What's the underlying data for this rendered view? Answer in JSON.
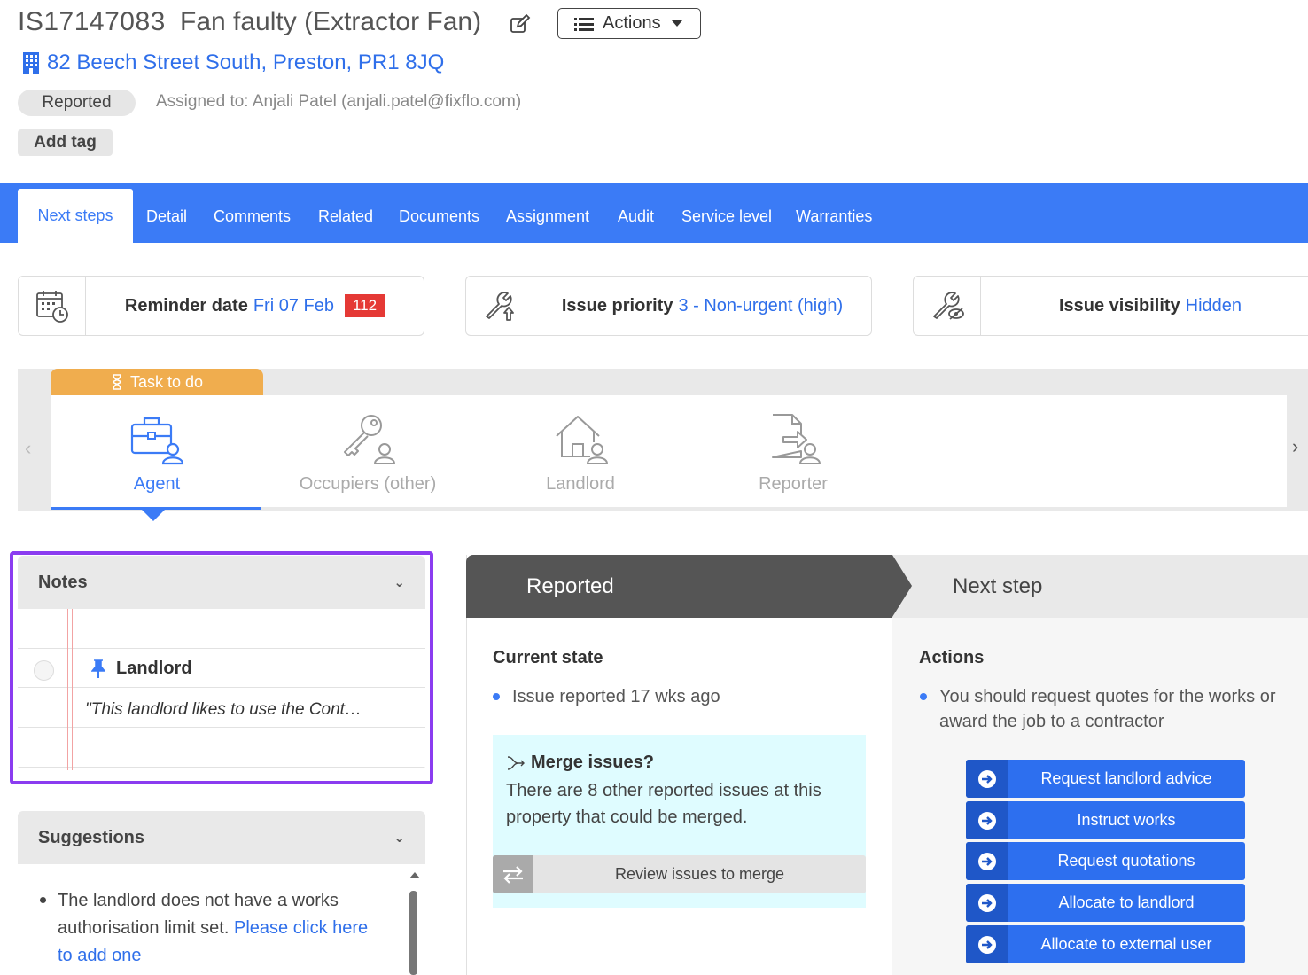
{
  "header": {
    "issue_id": "IS17147083",
    "title": "Fan faulty (Extractor Fan)",
    "actions_label": "Actions",
    "address": "82 Beech Street South, Preston, PR1 8JQ",
    "status": "Reported",
    "assigned": "Assigned to: Anjali Patel (anjali.patel@fixflo.com)",
    "add_tag": "Add tag"
  },
  "tabs": [
    {
      "label": "Next steps",
      "active": true
    },
    {
      "label": "Detail"
    },
    {
      "label": "Comments"
    },
    {
      "label": "Related"
    },
    {
      "label": "Documents"
    },
    {
      "label": "Assignment"
    },
    {
      "label": "Audit"
    },
    {
      "label": "Service level"
    },
    {
      "label": "Warranties"
    }
  ],
  "info_cards": {
    "reminder": {
      "label": "Reminder date",
      "value": "Fri 07 Feb",
      "badge": "112"
    },
    "priority": {
      "label": "Issue priority",
      "value": "3 - Non-urgent (high)"
    },
    "visibility": {
      "label": "Issue visibility",
      "value": "Hidden"
    }
  },
  "task": {
    "label": "Task to do",
    "roles": [
      {
        "label": "Agent",
        "icon": "briefcase-user-icon",
        "active": true
      },
      {
        "label": "Occupiers (other)",
        "icon": "key-user-icon"
      },
      {
        "label": "Landlord",
        "icon": "house-user-icon"
      },
      {
        "label": "Reporter",
        "icon": "document-arrow-user-icon"
      }
    ]
  },
  "notes": {
    "title": "Notes",
    "note_title": "Landlord",
    "note_text": "\"This landlord likes to use the Cont…"
  },
  "suggestions": {
    "title": "Suggestions",
    "text": "The landlord does not have a works authorisation limit set.",
    "link": "Please click here to add one"
  },
  "workflow": {
    "current_header": "Reported",
    "next_header": "Next step",
    "current_title": "Current state",
    "current_item": "Issue reported 17 wks ago",
    "merge_title": "Merge issues?",
    "merge_text": "There are 8 other reported issues at this property that could be merged.",
    "merge_button": "Review issues to merge",
    "actions_title": "Actions",
    "actions_item": "You should request quotes for the works or award the job to a contractor",
    "buttons": [
      "Request landlord advice",
      "Instruct works",
      "Request quotations",
      "Allocate to landlord",
      "Allocate to external user"
    ]
  },
  "colors": {
    "accent": "#3b7bf6",
    "task_label": "#f0ad4e",
    "badge": "#e53935",
    "highlight_frame": "#8b3cf0",
    "merge_bg": "#dffcff",
    "header_dark": "#555555"
  }
}
